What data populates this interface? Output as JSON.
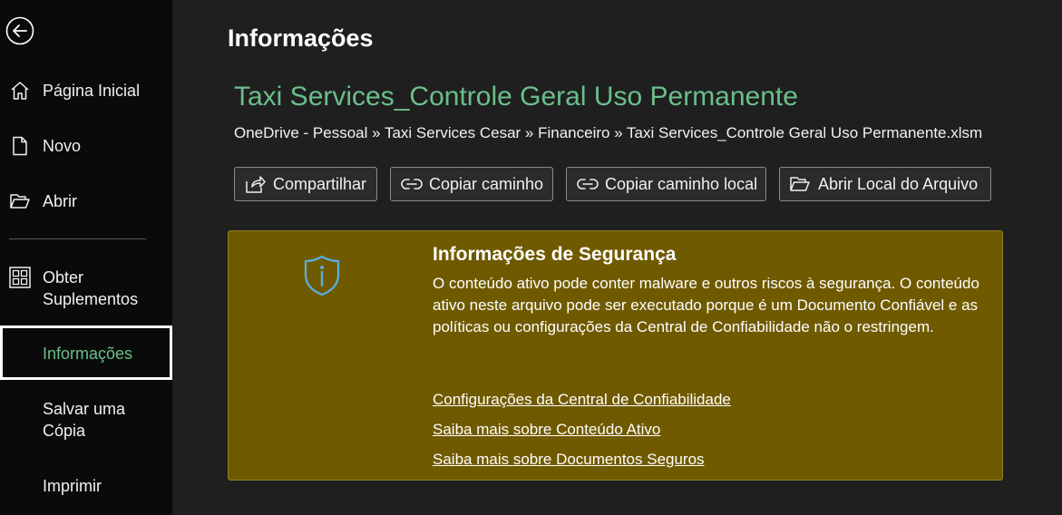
{
  "sidebar": {
    "back_icon": "back-arrow-circle-icon",
    "items": [
      {
        "label": "Página Inicial",
        "icon": "home-icon"
      },
      {
        "label": "Novo",
        "icon": "new-document-icon"
      },
      {
        "label": "Abrir",
        "icon": "folder-open-icon"
      },
      {
        "label": "Obter\nSuplementos",
        "icon": "grid-addins-icon"
      },
      {
        "label": "Informações",
        "active": true
      },
      {
        "label": "Salvar uma\nCópia"
      },
      {
        "label": "Imprimir"
      }
    ]
  },
  "main": {
    "page_title": "Informações",
    "doc_title": "Taxi Services_Controle Geral Uso Permanente",
    "breadcrumb": "OneDrive - Pessoal » Taxi Services Cesar » Financeiro » Taxi Services_Controle Geral Uso Permanente.xlsm",
    "actions": [
      {
        "label": "Compartilhar",
        "icon": "share-icon"
      },
      {
        "label": "Copiar caminho",
        "icon": "link-icon"
      },
      {
        "label": "Copiar caminho local",
        "icon": "link-icon"
      },
      {
        "label": "Abrir Local do Arquivo",
        "icon": "folder-open-icon"
      }
    ],
    "security": {
      "icon": "shield-info-icon",
      "title": "Informações de Segurança",
      "text": "O conteúdo ativo pode conter malware e outros riscos à segurança. O conteúdo ativo neste arquivo pode ser executado porque é um Documento Confiável e as políticas ou configurações da Central de Confiabilidade não o restringem.",
      "links": [
        "Configurações da Central de Confiabilidade",
        "Saiba mais sobre Conteúdo Ativo",
        "Saiba mais sobre Documentos Seguros"
      ]
    }
  },
  "colors": {
    "accent_green": "#6abf8a",
    "security_bg": "#705a00",
    "sidebar_bg": "#0a0a0a",
    "main_bg": "#1f1f1f"
  }
}
